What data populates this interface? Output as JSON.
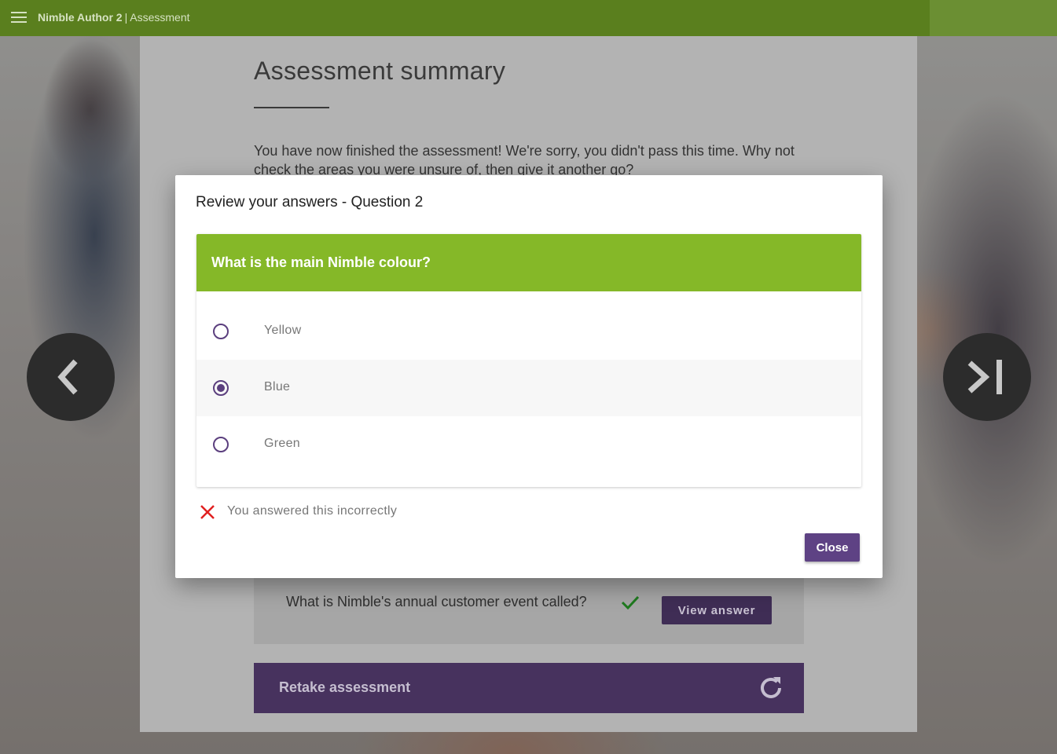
{
  "header": {
    "app_name": "Nimble Author 2",
    "separator": "|",
    "section": "Assessment",
    "menu_icon": "hamburger-menu-icon"
  },
  "page": {
    "title": "Assessment summary",
    "summary": "You have now finished the assessment! We're sorry, you didn't pass this time. Why not check the areas you were unsure of, then give it another go?",
    "question_row": {
      "text": "What is Nimble's annual customer event called?",
      "result_icon": "check-icon",
      "view_label": "View answer"
    },
    "retake": {
      "label": "Retake assessment",
      "icon": "refresh-icon"
    }
  },
  "navigation": {
    "prev_icon": "chevron-left-icon",
    "next_icon": "skip-next-icon"
  },
  "modal": {
    "title": "Review your answers - Question 2",
    "question": "What is the main Nimble colour?",
    "options": [
      {
        "label": "Yellow",
        "selected": false
      },
      {
        "label": "Blue",
        "selected": true
      },
      {
        "label": "Green",
        "selected": false
      }
    ],
    "feedback": {
      "icon": "close-x-icon",
      "text": "You answered this incorrectly"
    },
    "close_label": "Close"
  },
  "colors": {
    "brand_green": "#85b828",
    "header_green": "#5a7f1e",
    "accent_purple": "#5e4284",
    "error_red": "#e02020",
    "success_green": "#2e8b2e"
  }
}
